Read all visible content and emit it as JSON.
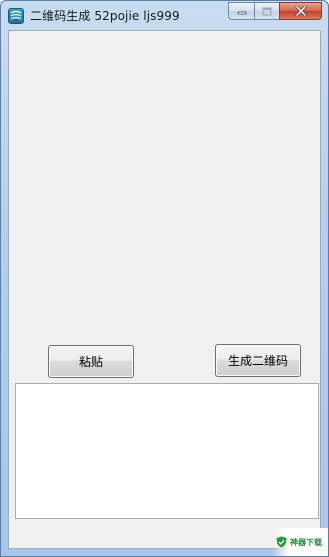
{
  "window": {
    "title": "二维码生成 52pojie ljs999"
  },
  "buttons": {
    "paste_label": "粘贴",
    "generate_label": "生成二维码"
  },
  "output": {
    "text": ""
  },
  "watermark": {
    "text": "神器下载",
    "color": "#2a8a3a"
  },
  "icons": {
    "app": "qr-app-icon",
    "minimize": "minimize-icon",
    "maximize": "maximize-icon",
    "close": "close-icon"
  },
  "colors": {
    "client_bg": "#f0f0f0",
    "close_button": "#c7442e",
    "frame": "#b5cfec"
  }
}
